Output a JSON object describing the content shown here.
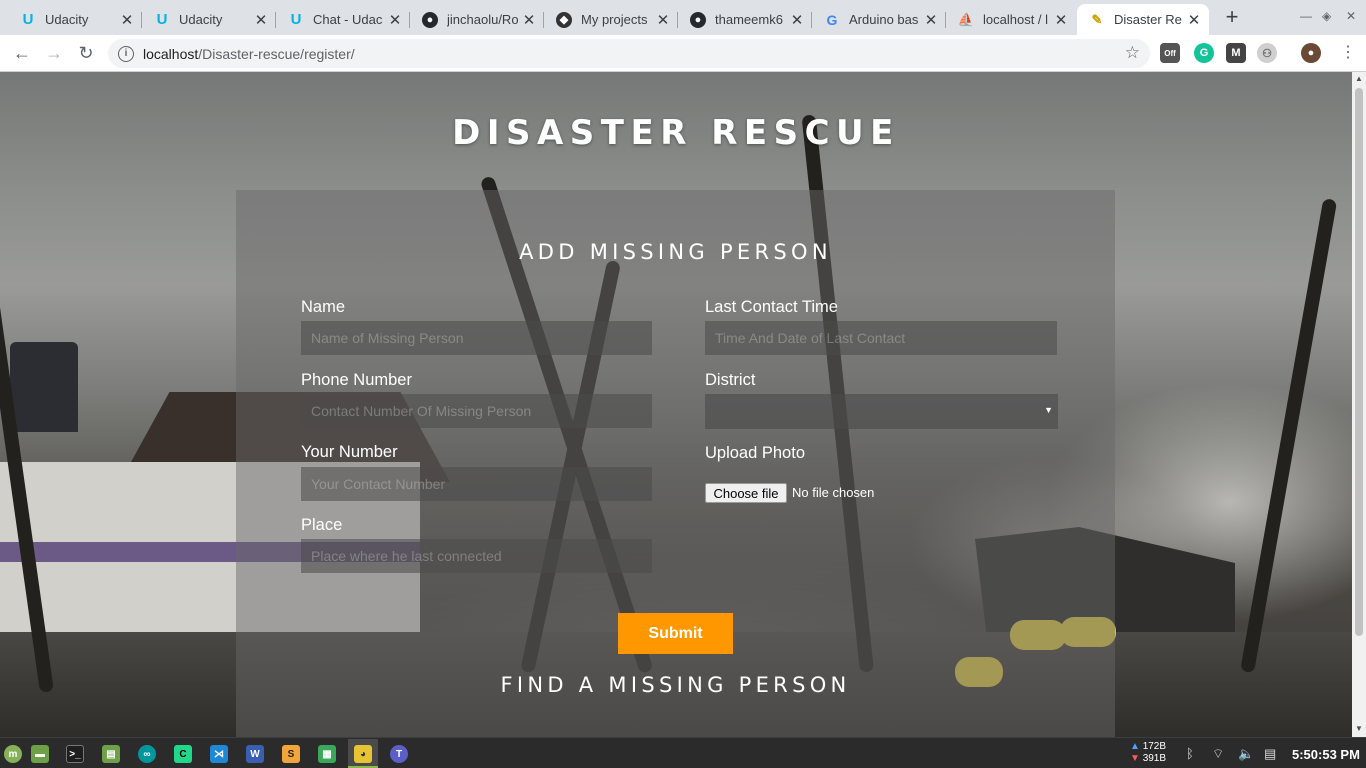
{
  "browser": {
    "tabs": [
      {
        "title": "Udacity",
        "icon": "udacity-icon",
        "color": "#02b3e4"
      },
      {
        "title": "Udacity",
        "icon": "udacity-icon",
        "color": "#02b3e4"
      },
      {
        "title": "Chat - Udac",
        "icon": "udacity-icon",
        "color": "#02b3e4"
      },
      {
        "title": "jinchaolu/Ro",
        "icon": "github-icon",
        "color": "#24292e"
      },
      {
        "title": "My projects",
        "icon": "compass-icon",
        "color": "#333333"
      },
      {
        "title": "thameemk6",
        "icon": "github-icon",
        "color": "#24292e"
      },
      {
        "title": "Arduino bas",
        "icon": "google-icon",
        "color": "#4285f4"
      },
      {
        "title": "localhost / l",
        "icon": "phpmyadmin-icon",
        "color": "#f29111"
      },
      {
        "title": "Disaster Re",
        "icon": "torch-icon",
        "color": "#c8a400"
      }
    ],
    "address": {
      "host": "localhost",
      "path": "/Disaster-rescue/register/"
    },
    "extensions": [
      "off-extension-icon",
      "grammarly-icon",
      "mendeley-icon",
      "extension-icon",
      "profile-avatar"
    ]
  },
  "page": {
    "site_title": "DISASTER RESCUE",
    "form_heading": "ADD MISSING PERSON",
    "fields": {
      "name": {
        "label": "Name",
        "placeholder": "Name of Missing Person"
      },
      "last_contact": {
        "label": "Last Contact Time",
        "placeholder": "Time And Date of Last Contact"
      },
      "phone": {
        "label": "Phone Number",
        "placeholder": "Contact Number Of Missing Person"
      },
      "district": {
        "label": "District",
        "value": ""
      },
      "your_number": {
        "label": "Your Number",
        "placeholder": "Your Contact Number"
      },
      "photo": {
        "label": "Upload Photo",
        "button": "Choose file",
        "status": "No file chosen"
      },
      "place": {
        "label": "Place",
        "placeholder": "Place where he last connected"
      }
    },
    "submit_label": "Submit",
    "find_heading": "FIND A MISSING PERSON",
    "accent_color": "#ff9800"
  },
  "taskbar": {
    "net_up": "172B",
    "net_down": "391B",
    "clock": "5:50:53 PM"
  }
}
